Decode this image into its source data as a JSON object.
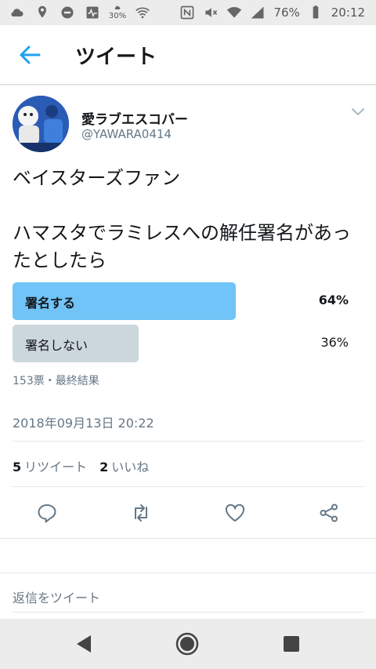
{
  "status_bar": {
    "battery": "76%",
    "time": "20:12",
    "weather_pct": "30%",
    "icons_left": [
      "cloud-icon",
      "location-icon",
      "do-not-disturb-icon",
      "activity-icon",
      "rain-cloud-icon",
      "wifi-icon"
    ],
    "icons_right": [
      "nfc-icon",
      "mute-icon",
      "wifi-signal-icon",
      "cell-signal-icon",
      "battery-icon"
    ]
  },
  "app_bar": {
    "back_icon": "arrow-left-icon",
    "title": "ツイート"
  },
  "tweet": {
    "user_name": "愛ラブエスコバー",
    "user_handle": "@YAWARA0414",
    "text_line1": "ベイスターズファン",
    "text_line2": "ハマスタでラミレスへの解任署名があっ",
    "text_line3": "たとしたら",
    "timestamp": "2018年09月13日 20:22"
  },
  "poll": {
    "options": [
      {
        "label": "署名する",
        "percent": "64%",
        "fraction": 0.64,
        "color": "#70c4f7",
        "winner": true
      },
      {
        "label": "署名しない",
        "percent": "36%",
        "fraction": 0.36,
        "color": "#ccd6dd",
        "winner": false
      }
    ],
    "meta": "153票・最終結果"
  },
  "stats": {
    "retweet_count": "5",
    "retweet_label": "リツイート",
    "like_count": "2",
    "like_label": "いいね"
  },
  "actions": [
    "reply-icon",
    "retweet-icon",
    "like-icon",
    "share-icon"
  ],
  "reply_compose": "返信をツイート",
  "colors": {
    "accent": "#1da1f2",
    "secondary_text": "#657786",
    "icon_gray": "#657786"
  }
}
